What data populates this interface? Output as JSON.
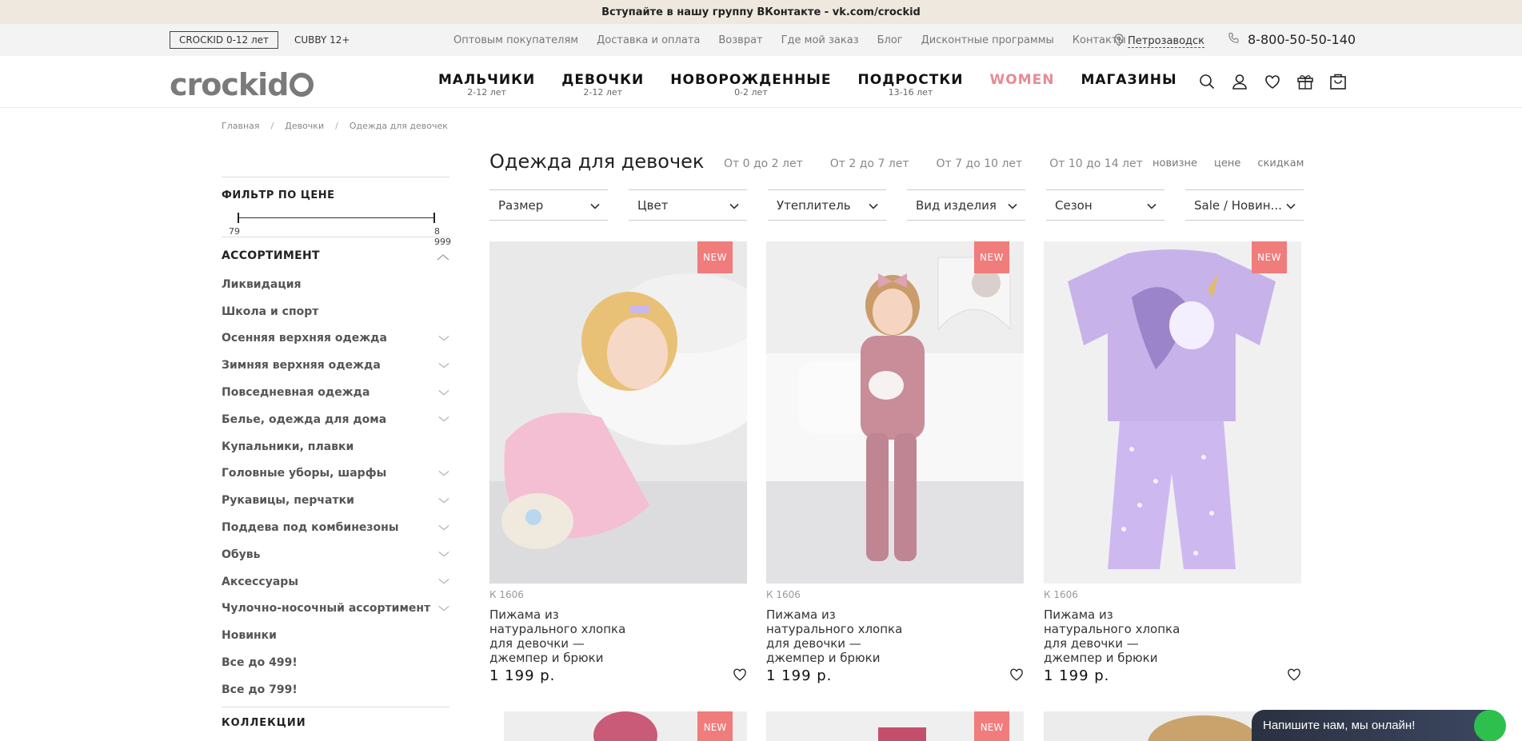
{
  "promo": {
    "text": "Вступайте в нашу группу ВКонтакте - vk.com/crockid"
  },
  "topbar": {
    "brand_active": "CROCKID 0-12 лет",
    "brand_other": "CUBBY 12+",
    "links": [
      "Оптовым покупателям",
      "Доставка и оплата",
      "Возврат",
      "Где мой заказ",
      "Блог",
      "Дисконтные программы",
      "Контакты"
    ],
    "city": "Петрозаводск",
    "phone": "8-800-50-50-140"
  },
  "header": {
    "logo_text": "crockid",
    "nav": [
      {
        "label": "МАЛЬЧИКИ",
        "age": "2-12 лет"
      },
      {
        "label": "ДЕВОЧКИ",
        "age": "2-12 лет"
      },
      {
        "label": "НОВОРОЖДЕННЫЕ",
        "age": "0-2 лет"
      },
      {
        "label": "ПОДРОСТКИ",
        "age": "13-16 лет"
      },
      {
        "label": "WOMEN",
        "age": ""
      },
      {
        "label": "МАГАЗИНЫ",
        "age": ""
      }
    ],
    "accent_color": "#e88a92"
  },
  "breadcrumb": {
    "items": [
      "Главная",
      "Девочки",
      "Одежда для девочек"
    ],
    "separator": "/"
  },
  "sidebar": {
    "price_filter_title": "ФИЛЬТР ПО ЦЕНЕ",
    "price_min": "79",
    "price_max": "8 999",
    "assortment_title": "АССОРТИМЕНТ",
    "categories": [
      {
        "label": "Ликвидация",
        "expandable": false
      },
      {
        "label": "Школа и спорт",
        "expandable": false
      },
      {
        "label": "Осенняя верхняя одежда",
        "expandable": true
      },
      {
        "label": "Зимняя верхняя одежда",
        "expandable": true
      },
      {
        "label": "Повседневная одежда",
        "expandable": true
      },
      {
        "label": "Белье, одежда для дома",
        "expandable": true
      },
      {
        "label": "Купальники, плавки",
        "expandable": false
      },
      {
        "label": "Головные уборы, шарфы",
        "expandable": true
      },
      {
        "label": "Рукавицы, перчатки",
        "expandable": true
      },
      {
        "label": "Поддева под комбинезоны",
        "expandable": true
      },
      {
        "label": "Обувь",
        "expandable": true
      },
      {
        "label": "Аксессуары",
        "expandable": true
      },
      {
        "label": "Чулочно-носочный ассортимент",
        "expandable": true
      },
      {
        "label": "Новинки",
        "expandable": false
      },
      {
        "label": "Все до 499!",
        "expandable": false
      },
      {
        "label": "Все до 799!",
        "expandable": false
      }
    ],
    "collections_title": "КОЛЛЕКЦИИ"
  },
  "catalog": {
    "title": "Одежда для девочек",
    "age_filters": [
      "От 0 до 2 лет",
      "От 2 до 7 лет",
      "От 7 до 10 лет",
      "От 10 до 14 лет"
    ],
    "sort": [
      "новизне",
      "цене",
      "скидкам"
    ],
    "filters": [
      "Размер",
      "Цвет",
      "Утеплитель",
      "Вид изделия",
      "Сезон",
      "Sale / Новин..."
    ],
    "badge_label": "NEW",
    "badge_color": "#f07c7c",
    "products": [
      {
        "sku": "К 1606",
        "name": "Пижама из натурального хлопка для девочки — джемпер и брюки",
        "price": "1 199 р."
      },
      {
        "sku": "К 1606",
        "name": "Пижама из натурального хлопка для девочки — джемпер и брюки",
        "price": "1 199 р."
      },
      {
        "sku": "К 1606",
        "name": "Пижама из натурального хлопка для девочки — джемпер и брюки",
        "price": "1 199 р."
      }
    ]
  },
  "chat": {
    "text": "Напишите нам, мы онлайн!"
  }
}
